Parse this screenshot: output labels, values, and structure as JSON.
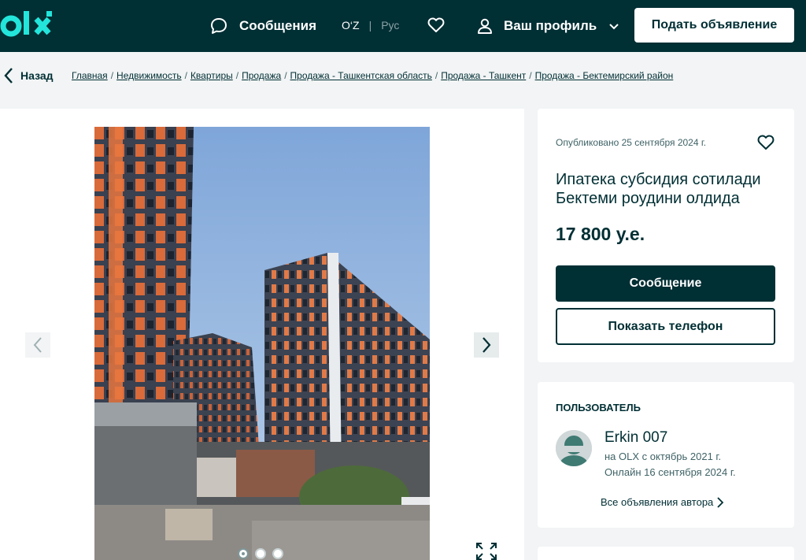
{
  "header": {
    "logo_text": "olx",
    "messages_label": "Сообщения",
    "lang_uz": "O‘Z",
    "lang_sep": "|",
    "lang_ru": "Рус",
    "profile_label": "Ваш профиль",
    "post_button": "Подать объявление",
    "icons": [
      "chat-icon",
      "heart-icon",
      "user-icon",
      "chevron-down-icon"
    ]
  },
  "nav": {
    "back_label": "Назад",
    "breadcrumbs": [
      "Главная",
      "Недвижимость",
      "Квартиры",
      "Продажа",
      "Продажа - Ташкентская область",
      "Продажа - Ташкент",
      "Продажа - Бектемирский район"
    ],
    "separator": "/"
  },
  "gallery": {
    "image_count": 3,
    "active_index": 0,
    "icons": [
      "chevron-left-icon",
      "chevron-right-icon",
      "expand-icon"
    ]
  },
  "ad": {
    "published": "Опубликовано 25 сентября 2024 г.",
    "title": "Ипатека субсидия сотилади Бектеми роудини олдида",
    "price": "17 800 у.е.",
    "message_button": "Сообщение",
    "phone_button": "Показать телефон"
  },
  "user": {
    "heading": "ПОЛЬЗОВАТЕЛЬ",
    "name": "Erkin 007",
    "since": "на OLX с октябрь 2021 г.",
    "online": "Онлайн 16 сентября 2024 г.",
    "all_ads_link": "Все объявления автора"
  },
  "colors": {
    "brand_dark": "#002f34",
    "logo_accent": "#23e5db",
    "background": "#f2f4f5"
  }
}
